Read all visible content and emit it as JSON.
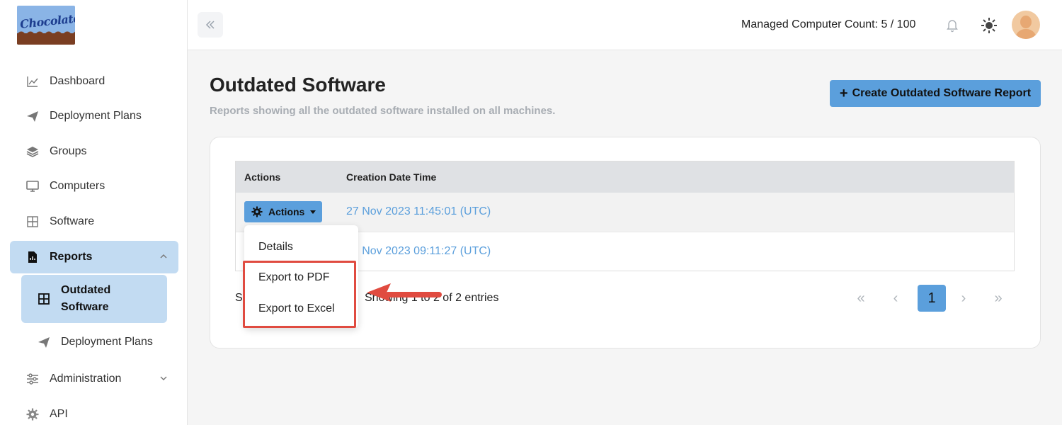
{
  "logo": {
    "text": "Chocolatey"
  },
  "sidebar": {
    "items": [
      {
        "label": "Dashboard",
        "icon": "chart-line-icon"
      },
      {
        "label": "Deployment Plans",
        "icon": "paper-plane-icon"
      },
      {
        "label": "Groups",
        "icon": "layers-icon"
      },
      {
        "label": "Computers",
        "icon": "monitor-icon"
      },
      {
        "label": "Software",
        "icon": "grid-icon"
      },
      {
        "label": "Reports",
        "icon": "report-file-icon",
        "active": true,
        "expanded": true
      },
      {
        "label": "Administration",
        "icon": "sliders-icon"
      },
      {
        "label": "API",
        "icon": "gear-icon"
      }
    ],
    "reports_sub": [
      {
        "label": "Outdated Software",
        "icon": "table-icon",
        "active": true
      },
      {
        "label": "Deployment Plans",
        "icon": "paper-plane-icon"
      }
    ]
  },
  "header": {
    "managed_count": "Managed Computer Count: 5 / 100"
  },
  "main": {
    "title": "Outdated Software",
    "subtitle": "Reports showing all the outdated software installed on all machines.",
    "create_button": "Create Outdated Software Report",
    "table": {
      "columns": [
        "Actions",
        "Creation Date Time"
      ],
      "rows": [
        {
          "date": "27 Nov 2023 11:45:01 (UTC)"
        },
        {
          "date": "27 Nov 2023 09:11:27 (UTC)"
        }
      ]
    },
    "actions_button": "Actions",
    "dropdown": [
      "Details",
      "Export to PDF",
      "Export to Excel"
    ],
    "footer_partial_left": "S",
    "footer_entries": "Showing 1 to 2 of 2 entries",
    "pagination": {
      "first": "«",
      "prev": "‹",
      "current": "1",
      "next": "›",
      "last": "»"
    }
  },
  "colors": {
    "accent": "#5b9fdc",
    "active_nav": "#c2dbf2",
    "highlight": "#e04b40"
  }
}
